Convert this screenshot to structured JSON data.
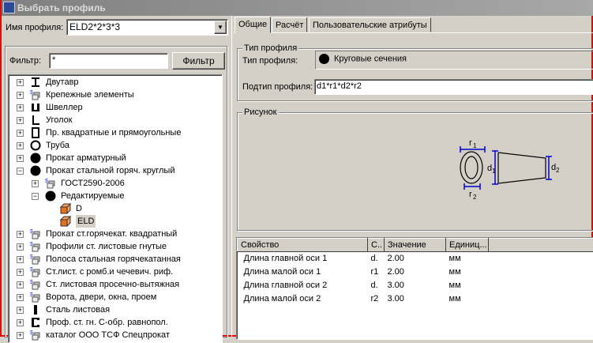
{
  "window": {
    "title": "Выбрать профиль"
  },
  "profile_name": {
    "label": "Имя профиля:",
    "value": "ELD2*2*3*3"
  },
  "filter": {
    "label": "Фильтр:",
    "value": "*",
    "button": "Фильтр"
  },
  "tree": [
    {
      "label": "Двутавр",
      "icon": "i-beam",
      "level": 0,
      "exp": "+"
    },
    {
      "label": "Крепежные элементы",
      "icon": "catalog",
      "level": 0,
      "exp": "+"
    },
    {
      "label": "Швеллер",
      "icon": "channel",
      "level": 0,
      "exp": "+"
    },
    {
      "label": "Уголок",
      "icon": "angle",
      "level": 0,
      "exp": "+"
    },
    {
      "label": "Пр. квадратные и прямоугольные",
      "icon": "rect-tube",
      "level": 0,
      "exp": "+"
    },
    {
      "label": "Труба",
      "icon": "pipe",
      "level": 0,
      "exp": "+"
    },
    {
      "label": "Прокат арматурный",
      "icon": "round",
      "level": 0,
      "exp": "+"
    },
    {
      "label": "Прокат стальной горяч. круглый",
      "icon": "round",
      "level": 0,
      "exp": "-"
    },
    {
      "label": "ГОСТ2590-2006",
      "icon": "catalog",
      "level": 1,
      "exp": "+"
    },
    {
      "label": "Редактируемые",
      "icon": "round",
      "level": 1,
      "exp": "-"
    },
    {
      "label": "D",
      "icon": "box",
      "level": 2,
      "exp": ""
    },
    {
      "label": "ELD",
      "icon": "box",
      "level": 2,
      "exp": "",
      "selected": true
    },
    {
      "label": "Прокат ст.горячекат. квадратный",
      "icon": "catalog",
      "level": 0,
      "exp": "+"
    },
    {
      "label": "Профили ст. листовые гнутые",
      "icon": "catalog",
      "level": 0,
      "exp": "+"
    },
    {
      "label": "Полоса стальная горячекатанная",
      "icon": "catalog",
      "level": 0,
      "exp": "+"
    },
    {
      "label": "Ст.лист. с ромб.и чечевич. риф.",
      "icon": "catalog",
      "level": 0,
      "exp": "+"
    },
    {
      "label": "Ст. листовая просечно-вытяжная",
      "icon": "catalog",
      "level": 0,
      "exp": "+"
    },
    {
      "label": "Ворота, двери, окна, проем",
      "icon": "catalog",
      "level": 0,
      "exp": "+"
    },
    {
      "label": "Сталь листовая",
      "icon": "plate",
      "level": 0,
      "exp": "+"
    },
    {
      "label": "Проф. ст. гн. С-обр. равнопол.",
      "icon": "c-profile",
      "level": 0,
      "exp": "+"
    },
    {
      "label": "каталог ООО ТСФ Спецпрокат",
      "icon": "catalog",
      "level": 0,
      "exp": "+"
    }
  ],
  "tabs": [
    "Общие",
    "Расчёт",
    "Пользовательские атрибуты"
  ],
  "type_group": {
    "title": "Тип профиля",
    "type_label": "Тип профиля:",
    "type_value": "Круговые сечения",
    "subtype_label": "Подтип профиля:",
    "subtype_value": "d1*r1*d2*r2"
  },
  "picture": {
    "title": "Рисунок",
    "labels": {
      "r1": "r1",
      "r2": "r2",
      "d1": "d1",
      "d2": "d2"
    }
  },
  "properties": {
    "columns": [
      "Свойство",
      "С..",
      "Значение",
      "Единиц..."
    ],
    "rows": [
      [
        "Длина главной оси 1",
        "d.",
        "2.00",
        "мм"
      ],
      [
        "Длина малой оси 1",
        "r1",
        "2.00",
        "мм"
      ],
      [
        "Длина главной оси 2",
        "d.",
        "3.00",
        "мм"
      ],
      [
        "Длина малой оси 2",
        "r2",
        "3.00",
        "мм"
      ]
    ]
  }
}
